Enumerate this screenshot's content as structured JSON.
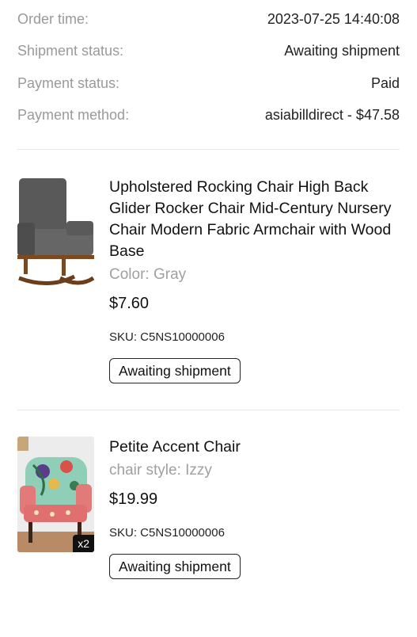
{
  "order_info": [
    {
      "label": "Order time:",
      "value": "2023-07-25 14:40:08"
    },
    {
      "label": "Shipment status:",
      "value": "Awaiting shipment"
    },
    {
      "label": "Payment status:",
      "value": "Paid"
    },
    {
      "label": "Payment method:",
      "value": "asiabilldirect -  $47.58"
    }
  ],
  "items": [
    {
      "title": "Upholstered Rocking Chair High Back Glider Rocker Chair Mid-Century Nursery Chair Modern Fabric Armchair with Wood Base",
      "variant": "Color: Gray",
      "price": "$7.60",
      "sku": "SKU: C5NS10000006",
      "status": "Awaiting shipment",
      "image_icon": "gray-rocking-chair-image"
    },
    {
      "title": "Petite Accent Chair",
      "variant": "chair style: Izzy",
      "price": "$19.99",
      "sku": "SKU: C5NS10000006",
      "status": "Awaiting shipment",
      "quantity": "x2",
      "image_icon": "floral-accent-chair-image"
    }
  ]
}
